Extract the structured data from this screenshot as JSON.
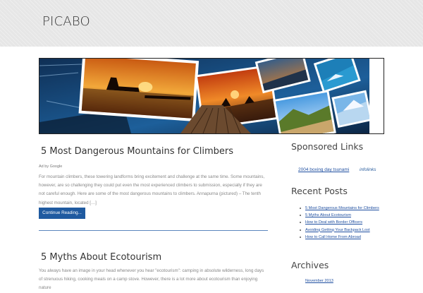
{
  "site": {
    "title": "PICABO"
  },
  "posts": [
    {
      "title": "5 Most Dangerous Mountains for Climbers",
      "ad_by": "Ad by Google",
      "excerpt": "For mountain climbers, these towering landforms bring excitement and challenge at the same time. Some mountains, however, are so challenging they could put even the most experienced climbers to submission, especially if they are not careful enough. Here are some of the most dangerous mountains to climbers. Annapurna (pictured) – The tenth highest mountain, located […]",
      "button_label": "Continue Reading..."
    },
    {
      "title": "5 Myths About Ecotourism",
      "excerpt": "You always have an image in your head whenever you hear \"ecotourism\": camping in absolute wilderness, long days of strenuous hiking, cooking meals on a camp stove. However, there is a lot more about ecotourism than enjoying nature"
    }
  ],
  "sidebar": {
    "sponsored": {
      "title": "Sponsored Links",
      "link": "2004 boxing day tsunami",
      "brand": "infolinks"
    },
    "recent": {
      "title": "Recent Posts",
      "items": [
        "5 Most Dangerous Mountains for Climbers",
        "5 Myths About Ecotourism",
        "How to Deal with Border Officers",
        "Avoiding Getting Your Backpack Lost",
        "How to Call Home From Abroad"
      ]
    },
    "archives": {
      "title": "Archives",
      "first_item": "November 2013"
    }
  },
  "colors": {
    "header_bg": "#e6e6e6",
    "accent": "#1f5aa0",
    "link": "#1f4fa0"
  }
}
